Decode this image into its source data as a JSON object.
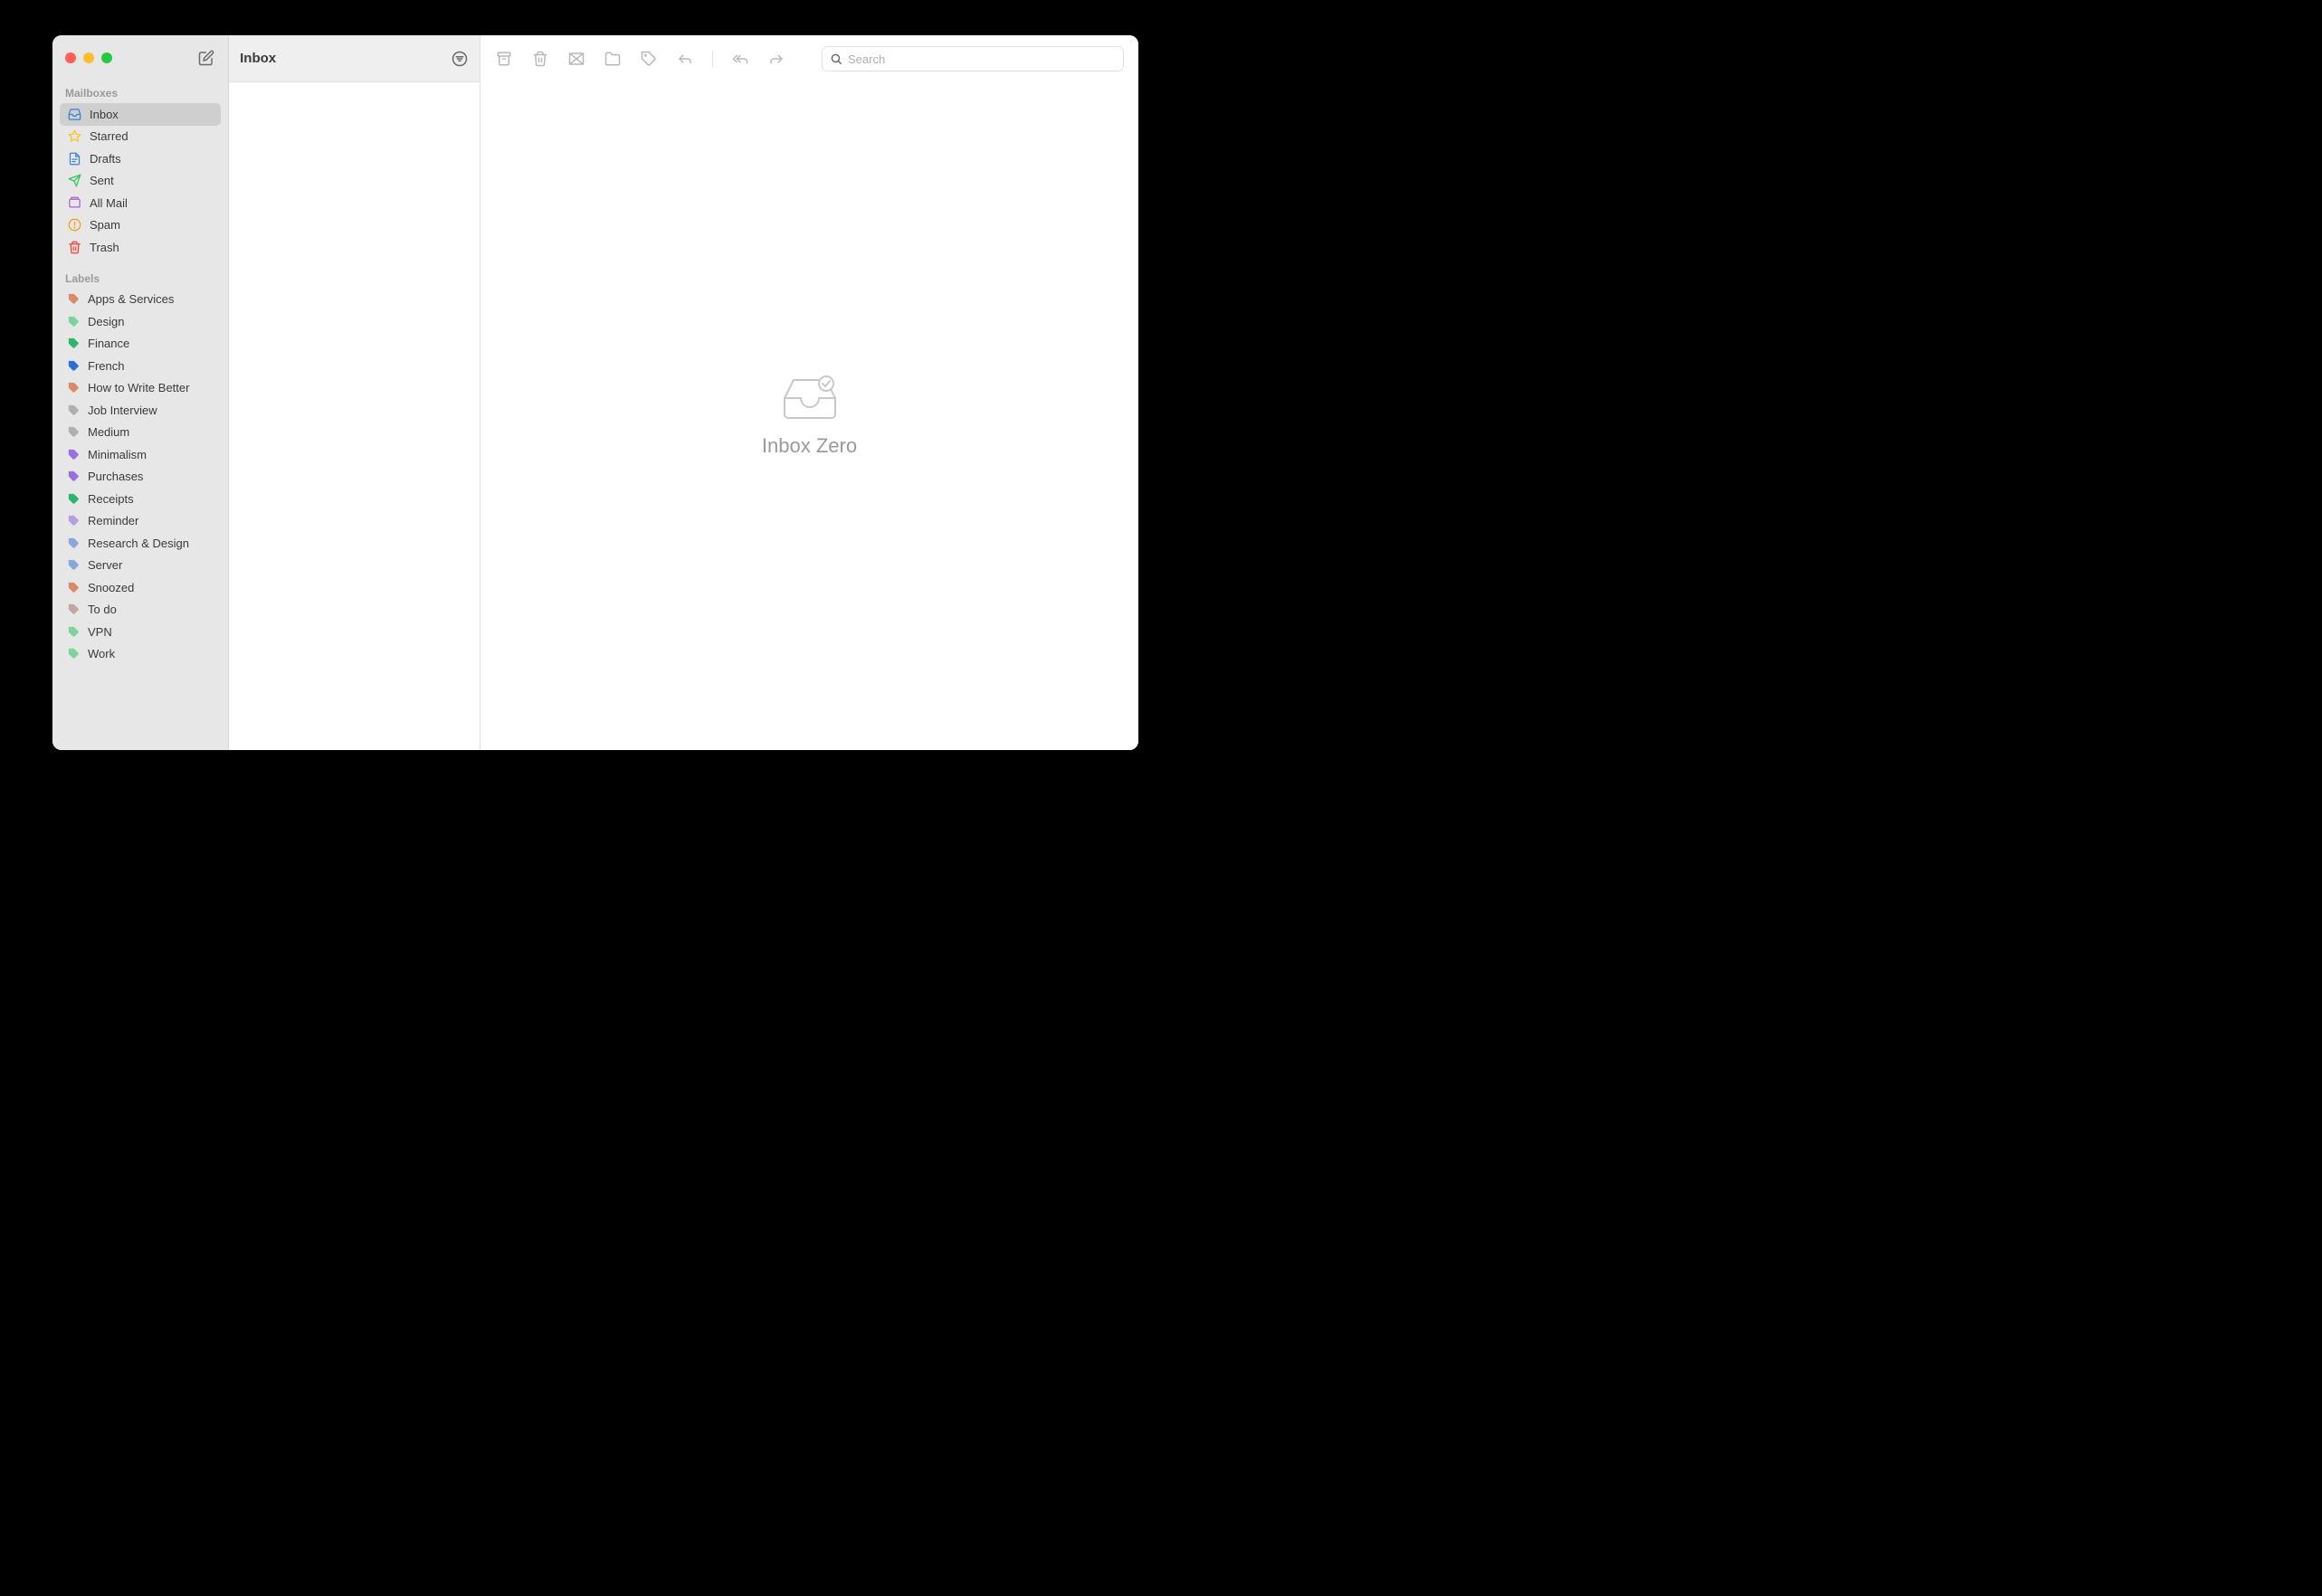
{
  "sidebar": {
    "section_mailboxes": "Mailboxes",
    "section_labels": "Labels",
    "mailboxes": [
      {
        "label": "Inbox",
        "icon": "inbox",
        "color": "#3b82d4",
        "selected": true
      },
      {
        "label": "Starred",
        "icon": "star",
        "color": "#f5c518"
      },
      {
        "label": "Drafts",
        "icon": "draft",
        "color": "#3b82d4"
      },
      {
        "label": "Sent",
        "icon": "sent",
        "color": "#34c759"
      },
      {
        "label": "All Mail",
        "icon": "allmail",
        "color": "#a85fd6"
      },
      {
        "label": "Spam",
        "icon": "spam",
        "color": "#f59e0b"
      },
      {
        "label": "Trash",
        "icon": "trash",
        "color": "#ff3b30"
      }
    ],
    "labels": [
      {
        "label": "Apps & Services",
        "color": "#d88a6a"
      },
      {
        "label": "Design",
        "color": "#7dd49b"
      },
      {
        "label": "Finance",
        "color": "#2fb56b"
      },
      {
        "label": "French",
        "color": "#2b6fd6"
      },
      {
        "label": "How to Write Better",
        "color": "#d88a6a"
      },
      {
        "label": "Job Interview",
        "color": "#b0b0b0"
      },
      {
        "label": "Medium",
        "color": "#b0b0b0"
      },
      {
        "label": "Minimalism",
        "color": "#9b6ee0"
      },
      {
        "label": "Purchases",
        "color": "#9b6ee0"
      },
      {
        "label": "Receipts",
        "color": "#2fb56b"
      },
      {
        "label": "Reminder",
        "color": "#b49fe0"
      },
      {
        "label": "Research & Design",
        "color": "#8aa7d9"
      },
      {
        "label": "Server",
        "color": "#8aa7d9"
      },
      {
        "label": "Snoozed",
        "color": "#d88a6a"
      },
      {
        "label": "To do",
        "color": "#c8a5a5"
      },
      {
        "label": "VPN",
        "color": "#7dd49b"
      },
      {
        "label": "Work",
        "color": "#7dd49b"
      }
    ]
  },
  "message_list": {
    "title": "Inbox"
  },
  "search": {
    "placeholder": "Search"
  },
  "empty_state": {
    "text": "Inbox Zero"
  }
}
